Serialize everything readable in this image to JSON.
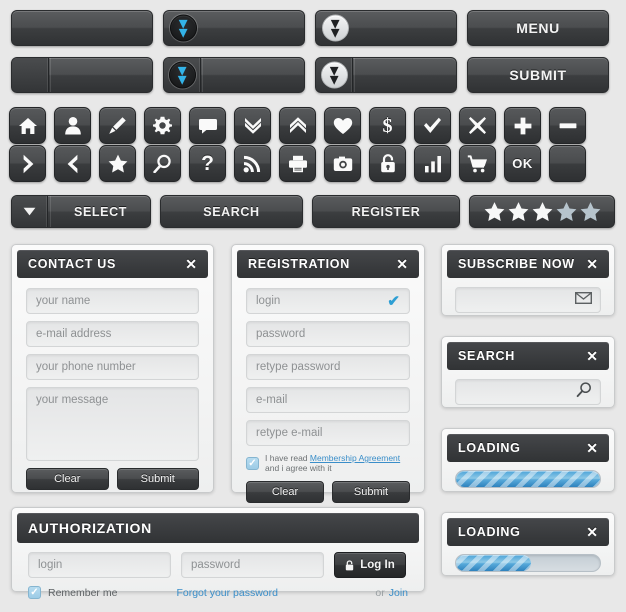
{
  "toolbar": {
    "top_row": [
      {
        "name": "plain-button",
        "label": "",
        "icon": "none",
        "style": "plain"
      },
      {
        "name": "chevron-blue-button",
        "label": "",
        "icon": "double-chevron-down-blue",
        "style": "circle-dark"
      },
      {
        "name": "chevron-light-button",
        "label": "",
        "icon": "double-chevron-down-dark",
        "style": "circle-light"
      },
      {
        "name": "menu-button",
        "label": "MENU",
        "icon": "none",
        "style": "text"
      }
    ],
    "second_row": [
      {
        "name": "split-plain-button",
        "label": "",
        "icon": "none",
        "style": "split"
      },
      {
        "name": "split-chevron-blue-button",
        "label": "",
        "icon": "double-chevron-down-blue",
        "style": "split-circle-dark"
      },
      {
        "name": "split-chevron-light-button",
        "label": "",
        "icon": "double-chevron-down-dark",
        "style": "split-circle-light"
      },
      {
        "name": "submit-button",
        "label": "SUBMIT",
        "icon": "none",
        "style": "text"
      }
    ]
  },
  "icon_buttons": {
    "row1": [
      {
        "name": "home-icon",
        "label": ""
      },
      {
        "name": "user-icon",
        "label": ""
      },
      {
        "name": "pencil-icon",
        "label": ""
      },
      {
        "name": "gear-icon",
        "label": ""
      },
      {
        "name": "chat-bubble-icon",
        "label": ""
      },
      {
        "name": "double-chevron-down-icon",
        "label": ""
      },
      {
        "name": "double-chevron-up-icon",
        "label": ""
      },
      {
        "name": "heart-icon",
        "label": ""
      },
      {
        "name": "dollar-icon",
        "label": ""
      },
      {
        "name": "check-icon",
        "label": ""
      },
      {
        "name": "close-x-icon",
        "label": ""
      },
      {
        "name": "plus-icon",
        "label": ""
      },
      {
        "name": "minus-icon",
        "label": ""
      }
    ],
    "row2": [
      {
        "name": "chevron-right-icon",
        "label": ""
      },
      {
        "name": "chevron-left-icon",
        "label": ""
      },
      {
        "name": "star-icon",
        "label": ""
      },
      {
        "name": "search-icon",
        "label": ""
      },
      {
        "name": "question-mark-icon",
        "label": ""
      },
      {
        "name": "rss-icon",
        "label": ""
      },
      {
        "name": "printer-icon",
        "label": ""
      },
      {
        "name": "camera-icon",
        "label": ""
      },
      {
        "name": "lock-icon",
        "label": ""
      },
      {
        "name": "bar-chart-icon",
        "label": ""
      },
      {
        "name": "shopping-cart-icon",
        "label": ""
      },
      {
        "name": "ok-button",
        "label": "OK"
      },
      {
        "name": "blank-icon-button",
        "label": ""
      }
    ]
  },
  "action_row": {
    "select": {
      "label": "SELECT",
      "dropdown_icon": "triangle-down-icon"
    },
    "search": {
      "label": "SEARCH"
    },
    "register": {
      "label": "REGISTER"
    },
    "rating": {
      "total": 5,
      "filled": 3,
      "filled_color": "#f7f8f8",
      "empty_color": "#b6c4cd"
    }
  },
  "contact_form": {
    "title": "CONTACT US",
    "close": "✕",
    "fields": [
      {
        "name": "name-input",
        "placeholder": "your name"
      },
      {
        "name": "email-input",
        "placeholder": "e-mail address"
      },
      {
        "name": "phone-input",
        "placeholder": "your phone number"
      }
    ],
    "message_placeholder": "your message",
    "clear_label": "Clear",
    "submit_label": "Submit"
  },
  "registration_form": {
    "title": "REGISTRATION",
    "close": "✕",
    "fields": [
      {
        "name": "login-input",
        "placeholder": "login",
        "valid": true
      },
      {
        "name": "password-input",
        "placeholder": "password",
        "valid": false
      },
      {
        "name": "retype-password-input",
        "placeholder": "retype password",
        "valid": false
      },
      {
        "name": "email-input",
        "placeholder": "e-mail",
        "valid": false
      },
      {
        "name": "retype-email-input",
        "placeholder": "retype e-mail",
        "valid": false
      }
    ],
    "valid_mark": "✔",
    "agreement_pre": "I have read",
    "agreement_link": "Membership Agreement",
    "agreement_post": "and i agree with it",
    "agreement_checked": true,
    "clear_label": "Clear",
    "submit_label": "Submit"
  },
  "subscribe_panel": {
    "title": "SUBSCRIBE NOW",
    "close": "✕",
    "input_placeholder": "",
    "icon": "envelope-icon"
  },
  "search_panel": {
    "title": "SEARCH",
    "close": "✕",
    "input_placeholder": "",
    "icon": "magnifier-icon"
  },
  "loading_panels": [
    {
      "title": "LOADING",
      "close": "✕",
      "progress": 100
    },
    {
      "title": "LOADING",
      "close": "✕",
      "progress": 52
    }
  ],
  "authorization": {
    "title": "AUTHORIZATION",
    "login_placeholder": "login",
    "password_placeholder": "password",
    "login_button_label": "Log In",
    "login_button_icon": "lock-icon",
    "remember_label": "Remember me",
    "remember_checked": true,
    "forgot_link": "Forgot your password",
    "or_text": "or",
    "join_link": "Join"
  },
  "colors": {
    "page_bg": "#e8e8e8",
    "panel_header": "#3a3c3e",
    "accent_blue": "#33b3e8",
    "link_blue": "#3a8ec9"
  }
}
